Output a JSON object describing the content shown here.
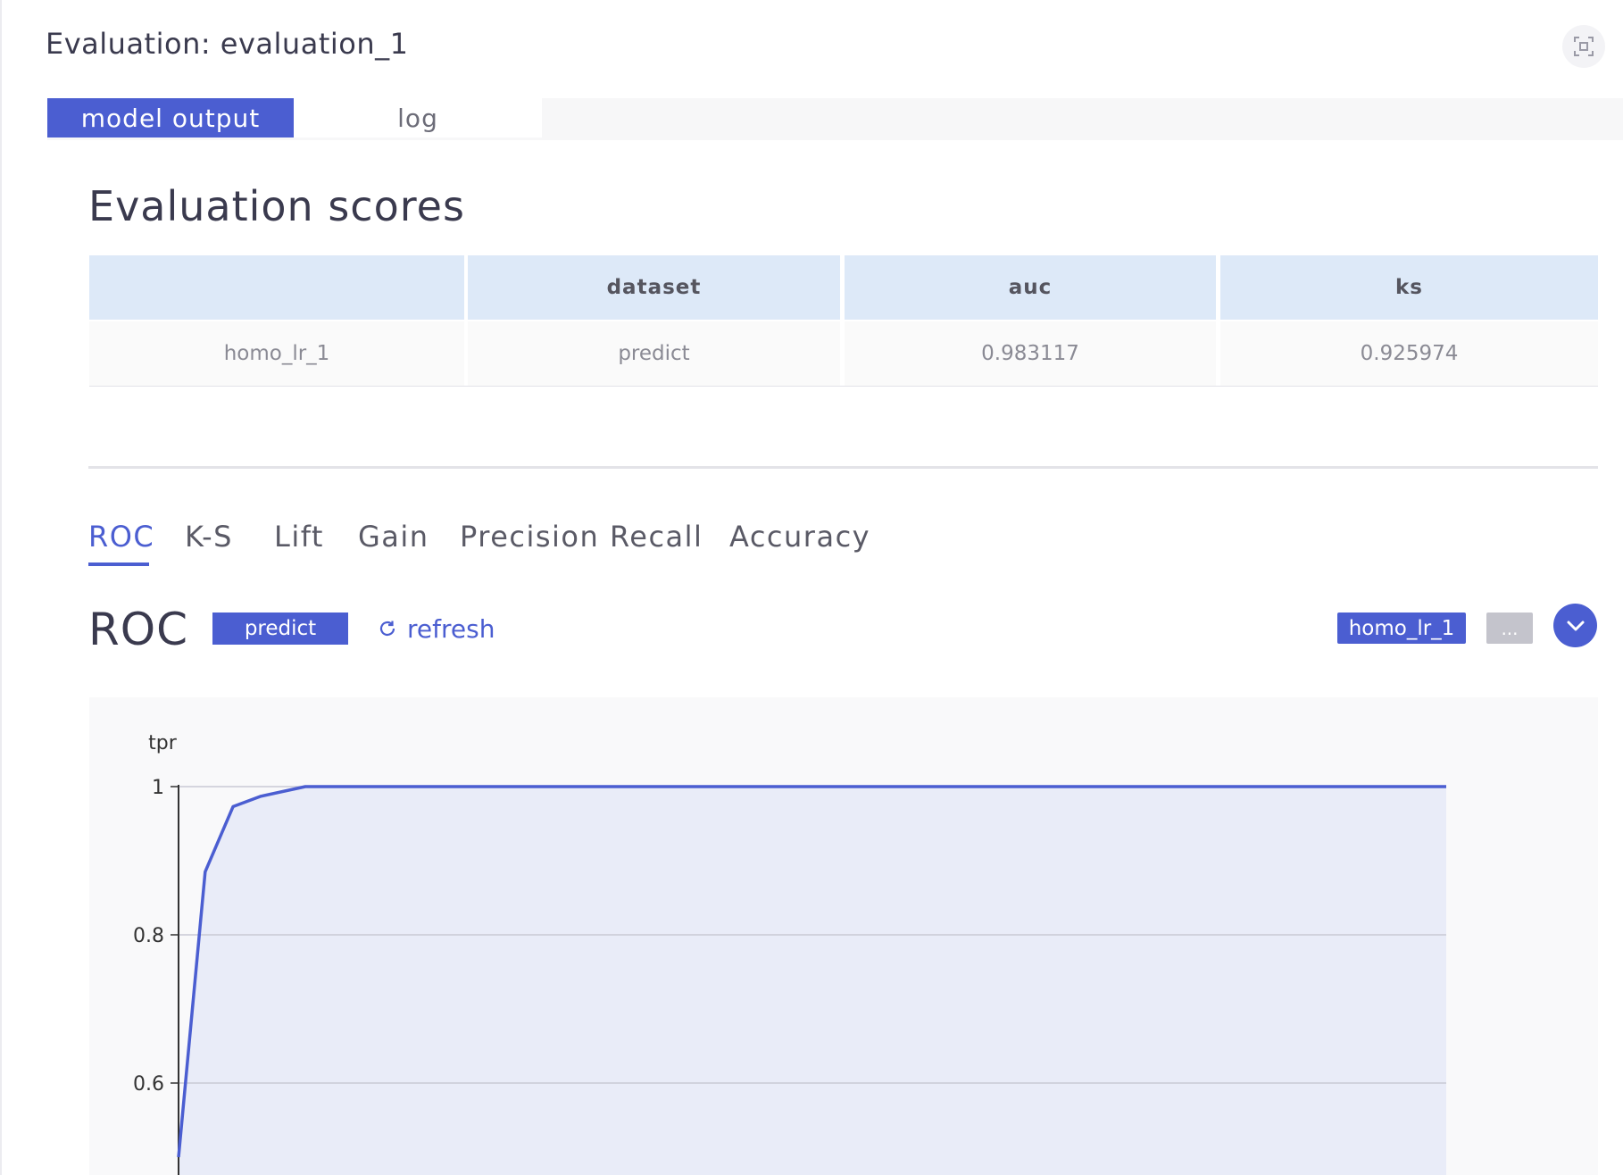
{
  "window": {
    "title": "Evaluation: evaluation_1"
  },
  "main_tabs": [
    {
      "label": "model output",
      "active": true
    },
    {
      "label": "log",
      "active": false
    }
  ],
  "scores": {
    "title": "Evaluation scores",
    "columns": [
      "",
      "dataset",
      "auc",
      "ks"
    ],
    "rows": [
      [
        "homo_lr_1",
        "predict",
        "0.983117",
        "0.925974"
      ]
    ]
  },
  "metric_tabs": [
    {
      "label": "ROC",
      "active": true
    },
    {
      "label": "K-S",
      "active": false
    },
    {
      "label": "Lift",
      "active": false
    },
    {
      "label": "Gain",
      "active": false
    },
    {
      "label": "Precision Recall",
      "active": false
    },
    {
      "label": "Accuracy",
      "active": false
    }
  ],
  "chart_header": {
    "title": "ROC",
    "dataset_chip": "predict",
    "refresh_label": "refresh",
    "model_chip": "homo_lr_1",
    "more_chip": "..."
  },
  "colors": {
    "accent": "#4b5ed1",
    "header_bg": "#dde9f8",
    "area_fill": "#e9ecf8"
  },
  "chart_data": {
    "type": "area",
    "title": "",
    "xlabel": "",
    "ylabel": "tpr",
    "ylim_visible": [
      0.5,
      1.0
    ],
    "yticks": [
      "1",
      "0.8",
      "0.6"
    ],
    "yticks_values": [
      1.0,
      0.8,
      0.6
    ],
    "grid": true,
    "series": [
      {
        "x": [
          0.0,
          0.021,
          0.043,
          0.065,
          0.1,
          0.2,
          0.3,
          0.4,
          0.5,
          0.6,
          0.7,
          0.8,
          0.9,
          1.0
        ],
        "y": [
          0.5,
          0.885,
          0.973,
          0.987,
          1.0,
          1.0,
          1.0,
          1.0,
          1.0,
          1.0,
          1.0,
          1.0,
          1.0,
          1.0
        ]
      }
    ]
  }
}
